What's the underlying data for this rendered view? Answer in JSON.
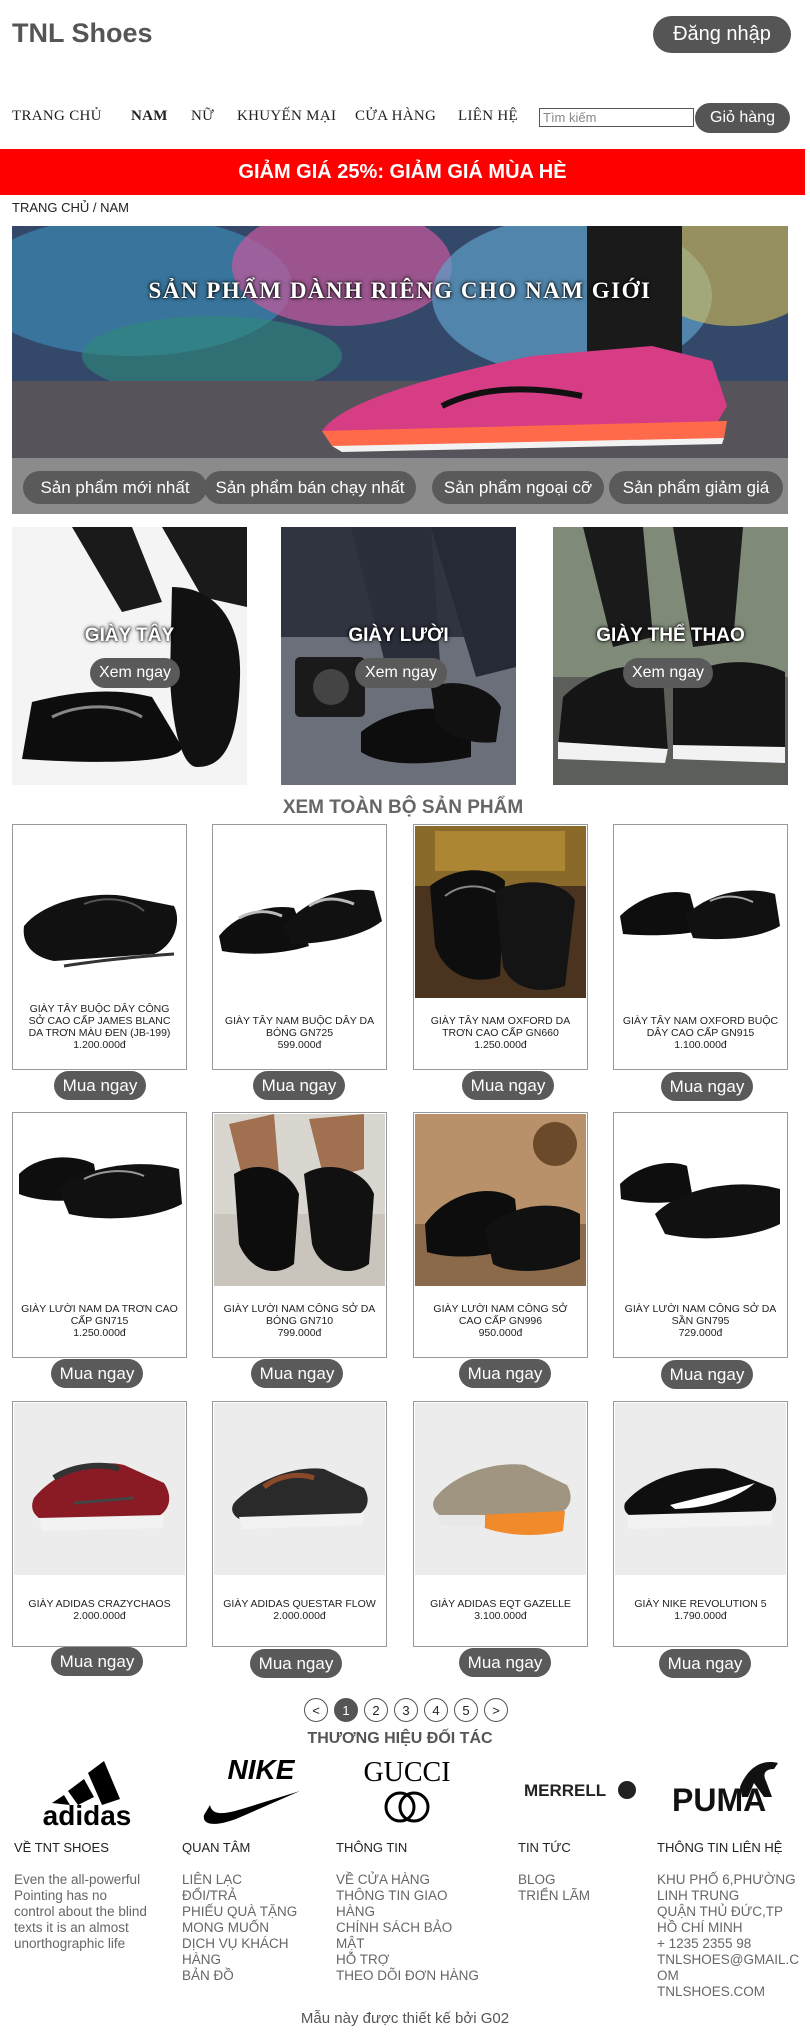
{
  "header": {
    "site_title": "TNL Shoes",
    "login_label": "Đăng nhập"
  },
  "nav": {
    "items": [
      "TRANG CHỦ",
      "NAM",
      "NỮ",
      "KHUYẾN MẠI",
      "CỬA HÀNG",
      "LIÊN HỆ"
    ],
    "active": "NAM",
    "search_placeholder": "Tìm kiếm",
    "cart_label": "Giỏ hàng"
  },
  "promo": {
    "text": "GIẢM GIÁ 25%: GIẢM GIÁ MÙA HÈ"
  },
  "breadcrumb": "TRANG CHỦ / NAM",
  "hero": {
    "title": "SẢN PHẨM DÀNH RIÊNG CHO NAM GIỚI",
    "filters": [
      "Sản phẩm mới nhất",
      "Sản phẩm bán chạy nhất",
      "Sản phẩm ngoại cỡ",
      "Sản phẩm giảm giá"
    ]
  },
  "categories": [
    {
      "label": "GIÀY TÂY",
      "button": "Xem ngay"
    },
    {
      "label": "GIÀY LƯỜI",
      "button": "Xem ngay"
    },
    {
      "label": "GIÀY THỂ THAO",
      "button": "Xem ngay"
    }
  ],
  "all_products_label": "XEM TOÀN BỘ SẢN PHẨM",
  "products": [
    {
      "name": "GIÀY TÂY BUỘC DÂY CÔNG SỞ CAO CẤP JAMES BLANC DA TRƠN MÀU ĐEN (JB-199)",
      "price": "1.200.000đ",
      "button": "Mua ngay"
    },
    {
      "name": "GIÀY TÂY NAM BUỘC DÂY DA BÓNG GN725",
      "price": "599.000đ",
      "button": "Mua ngay"
    },
    {
      "name": "GIÀY TÂY NAM OXFORD DA TRƠN CAO CẤP GN660",
      "price": "1.250.000đ",
      "button": "Mua ngay"
    },
    {
      "name": "GIÀY TÂY NAM OXFORD BUỘC DÂY CAO CẤP GN915",
      "price": "1.100.000đ",
      "button": "Mua ngay"
    },
    {
      "name": "GIÀY LƯỜI NAM DA TRƠN CAO CẤP GN715",
      "price": "1.250.000đ",
      "button": "Mua ngay"
    },
    {
      "name": "GIÀY LƯỜI NAM CÔNG SỞ DA BÓNG GN710",
      "price": "799.000đ",
      "button": "Mua ngay"
    },
    {
      "name": "GIÀY LƯỜI NAM CÔNG SỞ CAO CẤP GN996",
      "price": "950.000đ",
      "button": "Mua ngay"
    },
    {
      "name": "GIÀY LƯỜI NAM CÔNG SỞ DA SẦN GN795",
      "price": "729.000đ",
      "button": "Mua ngay"
    },
    {
      "name": "GIÀY ADIDAS CRAZYCHAOS",
      "price": "2.000.000đ",
      "button": "Mua ngay"
    },
    {
      "name": "GIÀY ADIDAS QUESTAR FLOW",
      "price": "2.000.000đ",
      "button": "Mua ngay"
    },
    {
      "name": "GIÀY ADIDAS EQT GAZELLE",
      "price": "3.100.000đ",
      "button": "Mua ngay"
    },
    {
      "name": "GIÀY NIKE REVOLUTION 5",
      "price": "1.790.000đ",
      "button": "Mua ngay"
    }
  ],
  "pagination": {
    "prev": "<",
    "pages": [
      "1",
      "2",
      "3",
      "4",
      "5"
    ],
    "current": "1",
    "next": ">"
  },
  "partners": {
    "title": "THƯƠNG HIỆU ĐỐI TÁC",
    "brands": [
      "adidas",
      "NIKE",
      "GUCCI",
      "MERRELL",
      "PUMA"
    ]
  },
  "footer": {
    "columns": [
      {
        "title": "VỀ TNT SHOES",
        "lines": [
          "Even the all-powerful",
          "Pointing has no",
          "control about the blind",
          "texts it is an almost",
          "unorthographic life"
        ]
      },
      {
        "title": "QUAN TÂM",
        "lines": [
          "LIÊN LẠC",
          "ĐỔI/TRẢ",
          "PHIẾU QUÀ TẶNG",
          "MONG MUỐN",
          "DỊCH VỤ KHÁCH",
          "HÀNG",
          "BẢN ĐỒ"
        ]
      },
      {
        "title": "THÔNG TIN",
        "lines": [
          "VỀ CỬA HÀNG",
          "THÔNG TIN GIAO",
          "HÀNG",
          "CHÍNH SÁCH BẢO",
          "MẬT",
          "HỖ TRỢ",
          "THEO DÕI ĐƠN HÀNG"
        ]
      },
      {
        "title": "TIN TỨC",
        "lines": [
          "BLOG",
          "TRIỂN LÃM"
        ]
      },
      {
        "title": "THÔNG TIN LIÊN HỆ",
        "lines": [
          "KHU PHỐ 6,PHƯỜNG",
          "LINH TRUNG",
          "QUẬN THỦ ĐỨC,TP",
          "HỒ CHÍ MINH",
          "+ 1235 2355 98",
          "TNLSHOES@GMAIL.C",
          "OM",
          "TNLSHOES.COM"
        ]
      }
    ],
    "credit": "Mẫu này được thiết kế bởi G02"
  },
  "colors": {
    "accent_gray": "#555555",
    "promo_red": "#ff0000"
  }
}
